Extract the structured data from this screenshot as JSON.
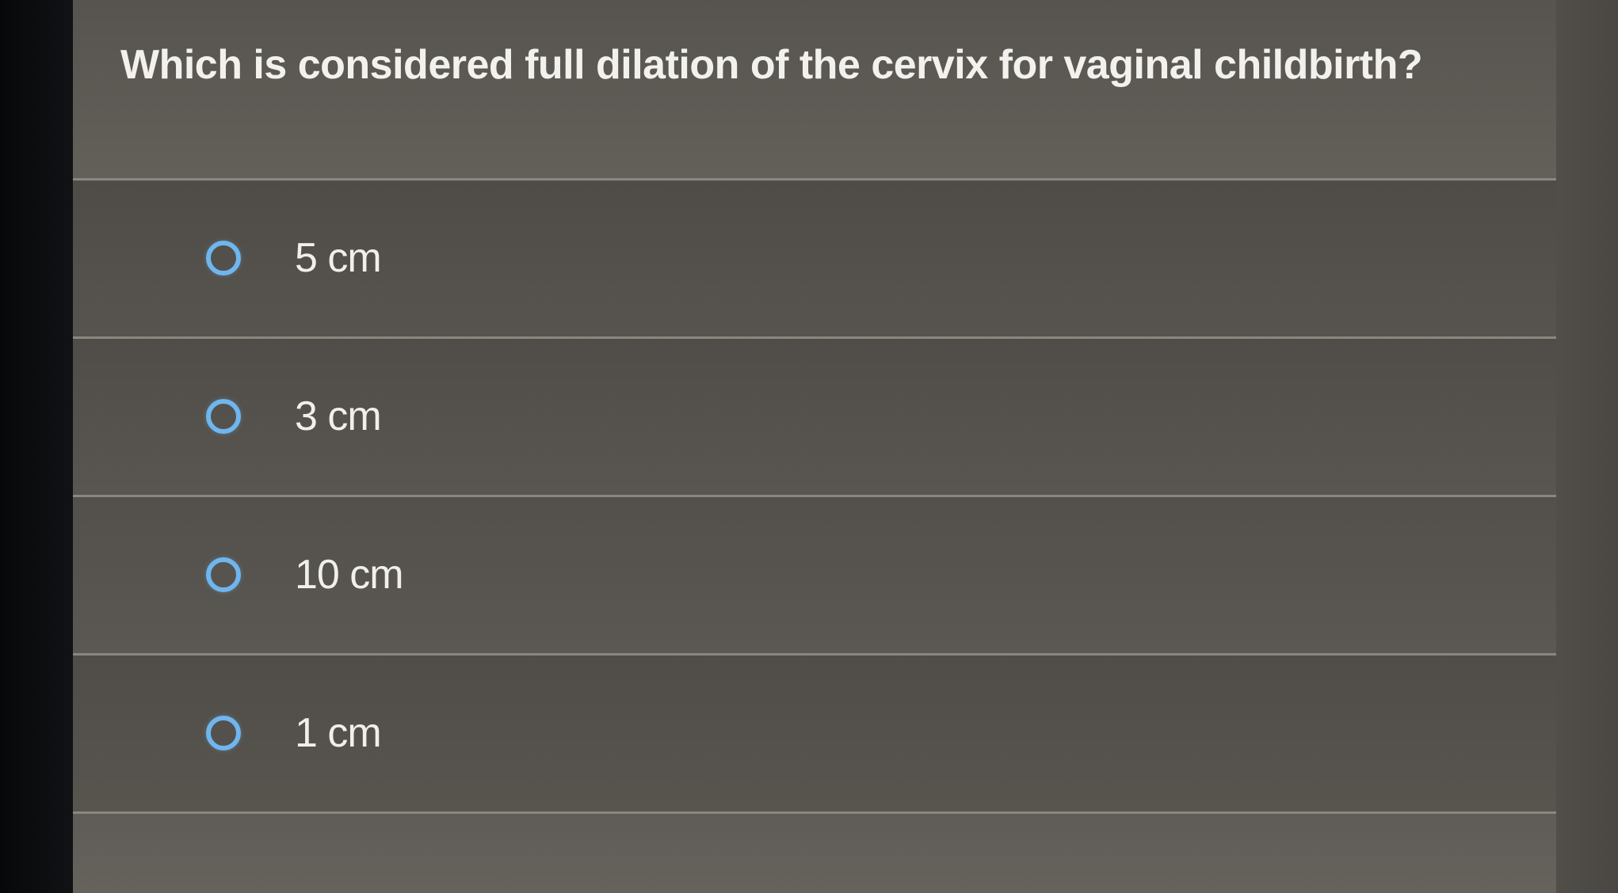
{
  "question": {
    "text": "Which is considered full dilation of the cervix for vaginal childbirth?"
  },
  "options": [
    {
      "label": "5 cm"
    },
    {
      "label": "3 cm"
    },
    {
      "label": "10 cm"
    },
    {
      "label": "1 cm"
    }
  ],
  "colors": {
    "radio_accent": "#6fb6ee",
    "panel_bg": "#5a5651",
    "divider": "#8a8781",
    "text": "#f1efec"
  }
}
